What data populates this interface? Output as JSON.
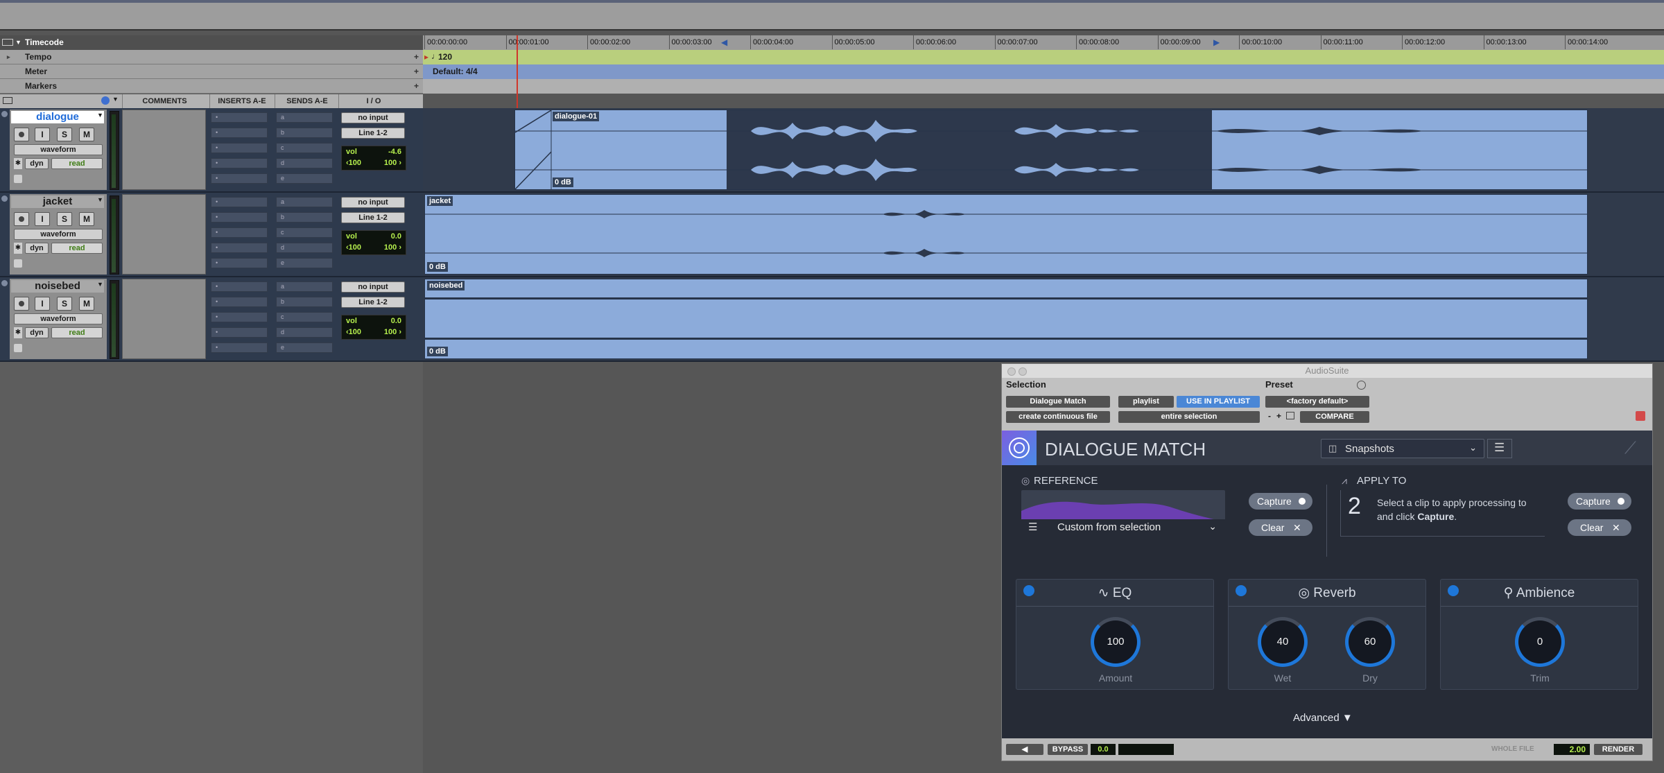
{
  "rulers": {
    "timecode": "Timecode",
    "tempo": "Tempo",
    "meter": "Meter",
    "markers": "Markers",
    "tempo_value": "120",
    "meter_value": "Default: 4/4",
    "ticks": [
      "00:00:00:00",
      "00:00:01:00",
      "00:00:02:00",
      "00:00:03:00",
      "00:00:04:00",
      "00:00:05:00",
      "00:00:06:00",
      "00:00:07:00",
      "00:00:08:00",
      "00:00:09:00",
      "00:00:10:00",
      "00:00:11:00",
      "00:00:12:00",
      "00:00:13:00",
      "00:00:14:00"
    ]
  },
  "columns": {
    "comments": "COMMENTS",
    "inserts": "INSERTS A-E",
    "sends": "SENDS A-E",
    "io": "I / O"
  },
  "tracks": [
    {
      "name": "dialogue",
      "view": "waveform",
      "dyn": "dyn",
      "auto": "read",
      "input": "no input",
      "output": "Line 1-2",
      "vol_label": "vol",
      "vol": "-4.6",
      "pan_l": "‹100",
      "pan_r": "100 ›",
      "clip": "dialogue-01",
      "gain": "0 dB"
    },
    {
      "name": "jacket",
      "view": "waveform",
      "dyn": "dyn",
      "auto": "read",
      "input": "no input",
      "output": "Line 1-2",
      "vol_label": "vol",
      "vol": "0.0",
      "pan_l": "‹100",
      "pan_r": "100 ›",
      "clip": "jacket",
      "gain": "0 dB"
    },
    {
      "name": "noisebed",
      "view": "waveform",
      "dyn": "dyn",
      "auto": "read",
      "input": "no input",
      "output": "Line 1-2",
      "vol_label": "vol",
      "vol": "0.0",
      "pan_l": "‹100",
      "pan_r": "100 ›",
      "clip": "noisebed",
      "gain": "0 dB"
    }
  ],
  "track_buttons": [
    "I",
    "S",
    "M"
  ],
  "send_letters": [
    "a",
    "b",
    "c",
    "d",
    "e"
  ],
  "audiosuite": {
    "title": "AudioSuite",
    "selection_label": "Selection",
    "preset_label": "Preset",
    "plugin": "Dialogue Match",
    "playlist": "playlist",
    "use_in_playlist": "USE IN PLAYLIST",
    "file_mode": "create continuous file",
    "process_mode": "entire selection",
    "preset": "<factory default>",
    "minus": "-",
    "plus": "+",
    "compare": "COMPARE",
    "plugin_title": "DIALOGUE MATCH",
    "snapshots": "Snapshots",
    "reference_label": "REFERENCE",
    "reference_source": "Custom from selection",
    "capture": "Capture",
    "clear": "Clear",
    "apply_label": "APPLY TO",
    "apply_step": "2",
    "apply_text_1": "Select a clip to apply processing to",
    "apply_text_2": "and click ",
    "apply_text_bold": "Capture",
    "apply_text_end": ".",
    "modules": {
      "eq": {
        "title": "EQ",
        "knobs": [
          {
            "value": "100",
            "label": "Amount"
          }
        ]
      },
      "reverb": {
        "title": "Reverb",
        "knobs": [
          {
            "value": "40",
            "label": "Wet"
          },
          {
            "value": "60",
            "label": "Dry"
          }
        ]
      },
      "ambience": {
        "title": "Ambience",
        "knobs": [
          {
            "value": "0",
            "label": "Trim"
          }
        ]
      }
    },
    "advanced": "Advanced",
    "bypass": "BYPASS",
    "bypass_value": "0.0",
    "whole_file": "WHOLE FILE",
    "handle_value": "2.00",
    "render": "RENDER"
  },
  "colors": {
    "accent": "#1e77d9",
    "clip": "#8cabda",
    "selection": "#2d384c",
    "tempo": "#b9cf7d",
    "meter": "#7f98c9",
    "meter_text": "#b6f04e"
  }
}
